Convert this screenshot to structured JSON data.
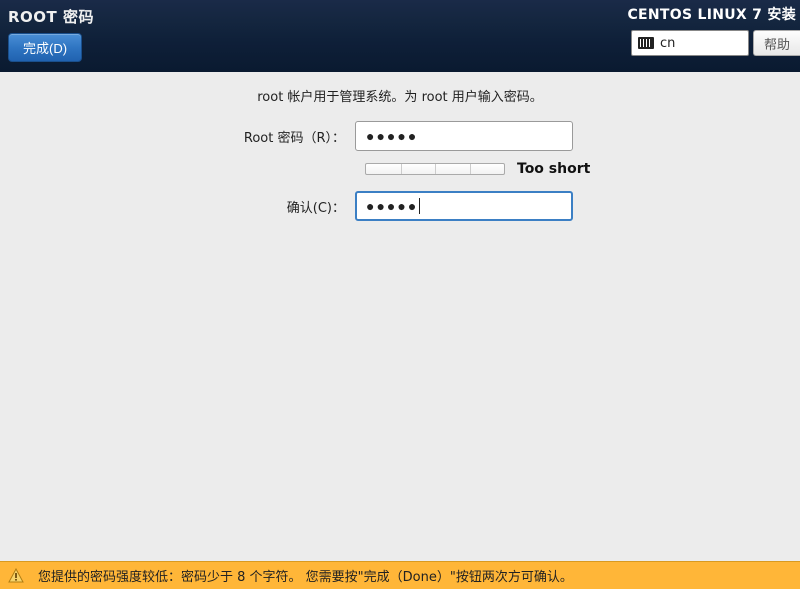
{
  "header": {
    "title": "ROOT 密码",
    "done_label": "完成(D)",
    "installer_title": "CENTOS LINUX 7 安装",
    "keyboard_layout": "cn",
    "help_label": "帮助"
  },
  "form": {
    "instructions": "root 帐户用于管理系统。为 root 用户输入密码。",
    "password_label": "Root 密码（R）：",
    "password_value": "●●●●●",
    "confirm_label": "确认(C)：",
    "confirm_value": "●●●●●",
    "strength_text": "Too short"
  },
  "warning": {
    "message": "您提供的密码强度较低：密码少于 8 个字符。 您需要按\"完成（Done）\"按钮两次方可确认。"
  }
}
